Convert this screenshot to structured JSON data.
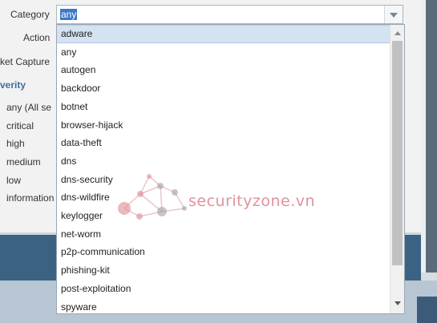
{
  "form": {
    "category_label": "Category",
    "action_label": "Action",
    "capture_label": "ket Capture",
    "severity_title": "verity",
    "category_value": "any"
  },
  "severity": {
    "items": [
      "any (All se",
      "critical",
      "high",
      "medium",
      "low",
      "information"
    ]
  },
  "dropdown": {
    "selected_index": 0,
    "options": [
      "adware",
      "any",
      "autogen",
      "backdoor",
      "botnet",
      "browser-hijack",
      "data-theft",
      "dns",
      "dns-security",
      "dns-wildfire",
      "keylogger",
      "net-worm",
      "p2p-communication",
      "phishing-kit",
      "post-exploitation",
      "spyware"
    ]
  },
  "watermark": {
    "text": "securityzone.vn"
  },
  "colors": {
    "accent": "#3d78c9",
    "selected_row": "#d4e2f2",
    "section_title": "#3c6e9e",
    "footer_bar": "#3c6283"
  },
  "icons": {
    "combo_trigger": "chevron-down-icon",
    "scroll_up": "scroll-up-icon",
    "scroll_down": "scroll-down-icon"
  }
}
